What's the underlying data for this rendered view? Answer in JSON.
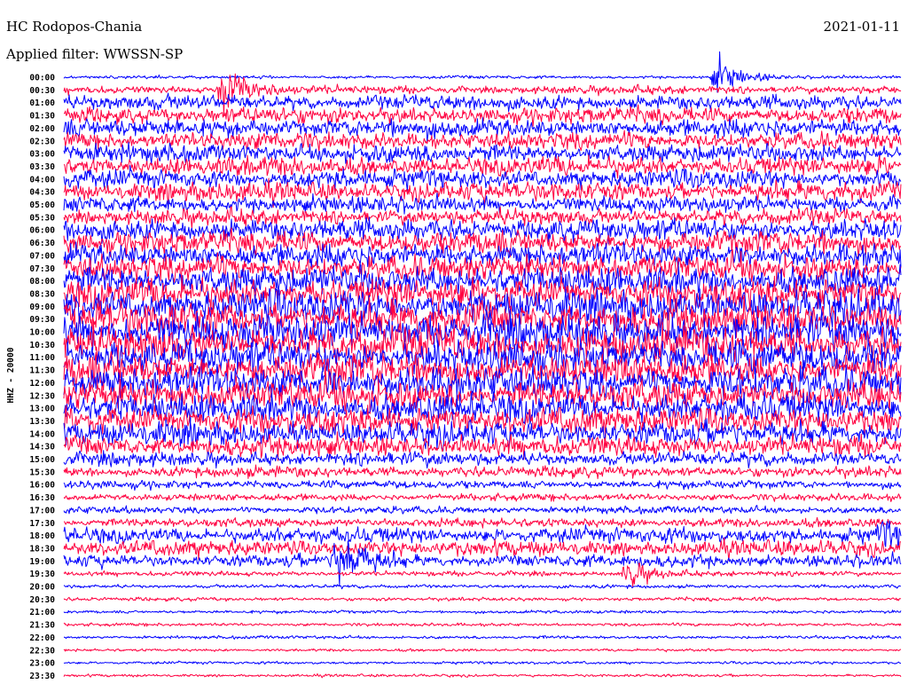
{
  "header": {
    "station": "HC Rodopos-Chania",
    "date": "2021-01-11",
    "filter": "Applied filter: WWSSN-SP"
  },
  "colors": {
    "trace_a": "#0000ff",
    "trace_b": "#ff0040",
    "background": "#ffffff"
  },
  "chart_data": {
    "type": "line",
    "title": "",
    "ylabel": "HHZ - 20000",
    "xlabel": "",
    "grid": false,
    "legend": "none",
    "row_labels": [
      "00:00",
      "00:30",
      "01:00",
      "01:30",
      "02:00",
      "02:30",
      "03:00",
      "03:30",
      "04:00",
      "04:30",
      "05:00",
      "05:30",
      "06:00",
      "06:30",
      "07:00",
      "07:30",
      "08:00",
      "08:30",
      "09:00",
      "09:30",
      "10:00",
      "10:30",
      "11:00",
      "11:30",
      "12:00",
      "12:30",
      "13:00",
      "13:30",
      "14:00",
      "14:30",
      "15:00",
      "15:30",
      "16:00",
      "16:30",
      "17:00",
      "17:30",
      "18:00",
      "18:30",
      "19:00",
      "19:30",
      "20:00",
      "20:30",
      "21:00",
      "21:30",
      "22:00",
      "22:30",
      "23:00",
      "23:30"
    ],
    "row_colors": [
      "trace_a",
      "trace_b",
      "trace_a",
      "trace_b",
      "trace_a",
      "trace_b",
      "trace_a",
      "trace_b",
      "trace_a",
      "trace_b",
      "trace_a",
      "trace_b",
      "trace_a",
      "trace_b",
      "trace_a",
      "trace_b",
      "trace_a",
      "trace_b",
      "trace_a",
      "trace_b",
      "trace_a",
      "trace_b",
      "trace_a",
      "trace_b",
      "trace_a",
      "trace_b",
      "trace_a",
      "trace_b",
      "trace_a",
      "trace_b",
      "trace_a",
      "trace_b",
      "trace_a",
      "trace_b",
      "trace_a",
      "trace_b",
      "trace_a",
      "trace_b",
      "trace_a",
      "trace_b",
      "trace_a",
      "trace_b",
      "trace_a",
      "trace_b",
      "trace_a",
      "trace_b",
      "trace_a",
      "trace_b"
    ],
    "row_amplitude": [
      0.35,
      0.9,
      1.6,
      1.8,
      2.0,
      1.9,
      2.0,
      2.1,
      2.0,
      2.1,
      1.8,
      1.7,
      2.4,
      2.5,
      2.6,
      2.8,
      3.2,
      3.3,
      3.6,
      3.8,
      3.9,
      3.8,
      3.7,
      3.6,
      3.5,
      3.3,
      3.2,
      3.0,
      2.6,
      2.3,
      1.5,
      1.2,
      0.9,
      0.8,
      0.8,
      1.0,
      1.7,
      1.7,
      1.4,
      0.55,
      0.4,
      0.4,
      0.35,
      0.35,
      0.35,
      0.3,
      0.3,
      0.3
    ],
    "events": [
      {
        "row": 1,
        "minute": 5.7,
        "amplitude": 6.0
      },
      {
        "row": 0,
        "minute": 23.4,
        "amplitude": 4.5
      },
      {
        "row": 38,
        "minute": 9.8,
        "amplitude": 8.0
      },
      {
        "row": 39,
        "minute": 20.2,
        "amplitude": 3.5
      },
      {
        "row": 36,
        "minute": 29.3,
        "amplitude": 2.5
      }
    ]
  }
}
